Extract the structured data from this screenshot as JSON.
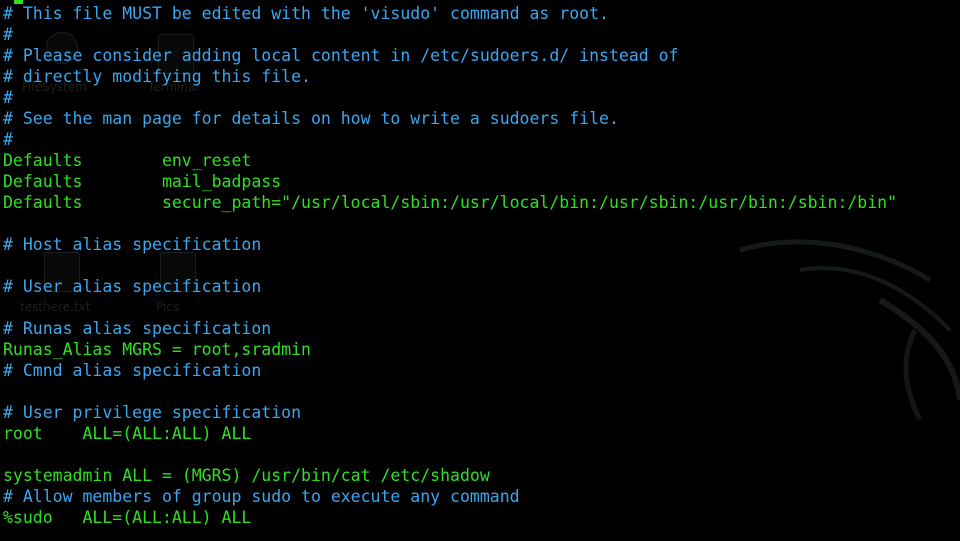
{
  "window": {
    "title": "",
    "background": "#000000"
  },
  "colors": {
    "comment": "#3aa7f0",
    "code": "#2fe021"
  },
  "desktop_ghost": {
    "labels": [
      "FileSystem",
      "Terminal",
      "testhere.txt",
      "Pics"
    ]
  },
  "editor": {
    "lines": [
      {
        "type": "comment",
        "text": "# This file MUST be edited with the 'visudo' command as root."
      },
      {
        "type": "comment",
        "text": "#"
      },
      {
        "type": "comment",
        "text": "# Please consider adding local content in /etc/sudoers.d/ instead of"
      },
      {
        "type": "comment",
        "text": "# directly modifying this file."
      },
      {
        "type": "comment",
        "text": "#"
      },
      {
        "type": "comment",
        "text": "# See the man page for details on how to write a sudoers file."
      },
      {
        "type": "comment",
        "text": "#"
      },
      {
        "type": "code",
        "text": "Defaults        env_reset"
      },
      {
        "type": "code",
        "text": "Defaults        mail_badpass"
      },
      {
        "type": "code",
        "text": "Defaults        secure_path=\"/usr/local/sbin:/usr/local/bin:/usr/sbin:/usr/bin:/sbin:/bin\""
      },
      {
        "type": "code",
        "text": ""
      },
      {
        "type": "comment",
        "text": "# Host alias specification"
      },
      {
        "type": "code",
        "text": ""
      },
      {
        "type": "comment",
        "text": "# User alias specification"
      },
      {
        "type": "code",
        "text": ""
      },
      {
        "type": "comment",
        "text": "# Runas alias specification"
      },
      {
        "type": "code",
        "text": "Runas_Alias MGRS = root,sradmin"
      },
      {
        "type": "comment",
        "text": "# Cmnd alias specification"
      },
      {
        "type": "code",
        "text": ""
      },
      {
        "type": "comment",
        "text": "# User privilege specification"
      },
      {
        "type": "code",
        "text": "root    ALL=(ALL:ALL) ALL"
      },
      {
        "type": "code",
        "text": ""
      },
      {
        "type": "code",
        "text": "systemadmin ALL = (MGRS) /usr/bin/cat /etc/shadow"
      },
      {
        "type": "comment",
        "text": "# Allow members of group sudo to execute any command"
      },
      {
        "type": "code",
        "text": "%sudo   ALL=(ALL:ALL) ALL"
      }
    ]
  }
}
